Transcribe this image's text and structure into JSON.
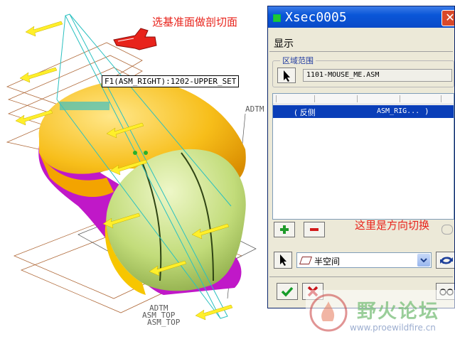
{
  "viewport": {
    "annotation_top": "选基准面做剖切面",
    "tooltip": "F1(ASM_RIGHT):1202-UPPER_SET",
    "datum_labels": [
      "ADTM",
      "ADTM",
      "ASM_TOP",
      "ASM_TOP"
    ]
  },
  "dialog": {
    "title": "Xsec0005",
    "menu_display": "显示",
    "region_label": "区域范围",
    "region_value": "1101-MOUSE_ME.ASM",
    "list_row": {
      "direction": "( 反侧",
      "reference": "ASM_RIG...",
      "close": ")"
    },
    "direction_annotation": "这里是方向切换",
    "halfspace_label": "半空间"
  },
  "watermark": {
    "name": "野火论坛",
    "url": "www.proewildfire.cn"
  },
  "colors": {
    "titlebar": "#0a56d8",
    "annotation": "#e8231b",
    "part_yellow": "#f5b400",
    "part_green": "#b7d36a",
    "part_magenta": "#c018c8"
  }
}
